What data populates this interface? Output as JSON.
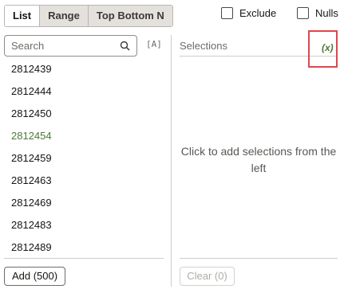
{
  "tabs": [
    "List",
    "Range",
    "Top Bottom N"
  ],
  "options": {
    "exclude": "Exclude",
    "nulls": "Nulls"
  },
  "search": {
    "placeholder": "Search",
    "value": ""
  },
  "toggle_text": "[A]",
  "list_items": [
    "2812439",
    "2812444",
    "2812450",
    "2812454",
    "2812459",
    "2812463",
    "2812469",
    "2812483",
    "2812489"
  ],
  "add_button": "Add (500)",
  "selections": {
    "title": "Selections",
    "expression": "(x)",
    "hint": "Click to add selections from the left",
    "clear_button": "Clear (0)"
  },
  "colors": {
    "accent": "#4b7a34",
    "highlight": "#e0454b"
  }
}
